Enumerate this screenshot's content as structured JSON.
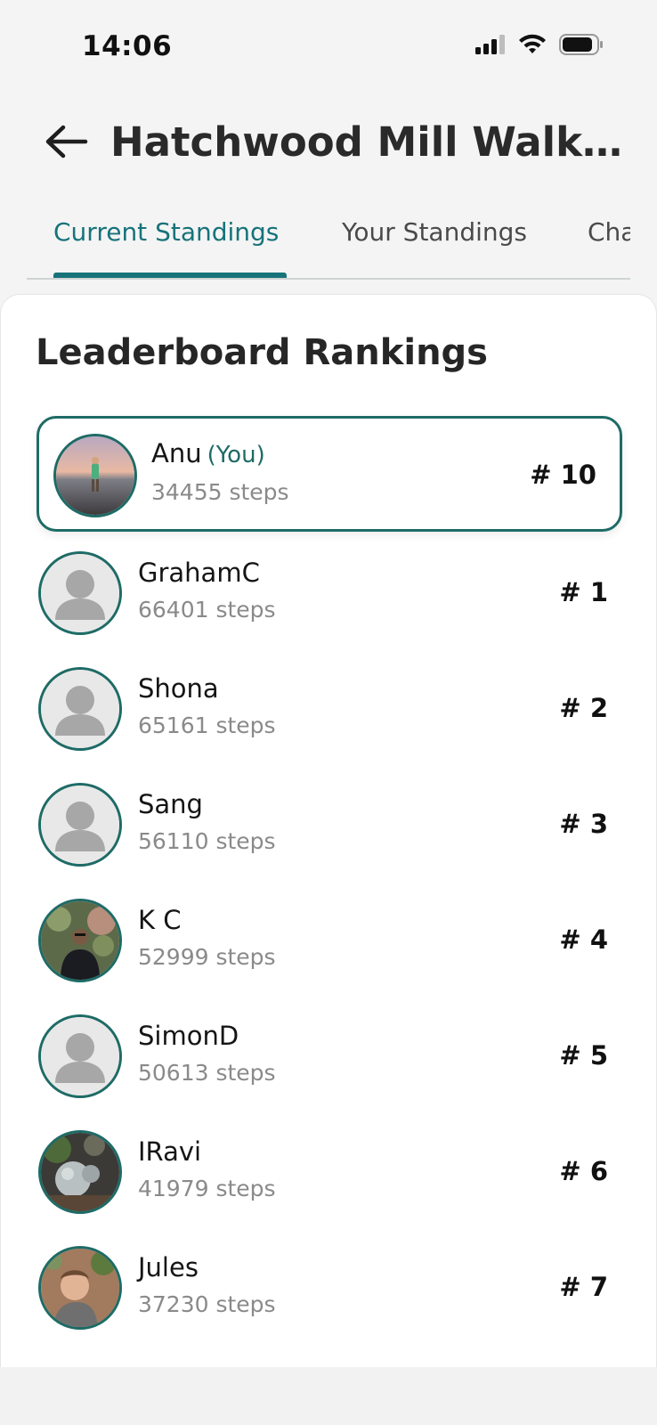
{
  "status_bar": {
    "time": "14:06",
    "icons": [
      "signal-icon",
      "wifi-icon",
      "battery-icon"
    ]
  },
  "header": {
    "back_icon": "arrow-left-icon",
    "title": "Hatchwood Mill Walkin..."
  },
  "tabs": [
    {
      "label": "Current Standings",
      "active": true
    },
    {
      "label": "Your Standings",
      "active": false
    },
    {
      "label": "Cha",
      "active": false
    }
  ],
  "leaderboard": {
    "title": "Leaderboard Rankings",
    "current_user": {
      "name": "Anu",
      "you_label": "(You)",
      "steps": "34455 steps",
      "rank": "# 10",
      "avatar": "photo"
    },
    "entries": [
      {
        "name": "GrahamC",
        "steps": "66401 steps",
        "rank": "# 1",
        "avatar": "default"
      },
      {
        "name": "Shona",
        "steps": "65161 steps",
        "rank": "# 2",
        "avatar": "default"
      },
      {
        "name": "Sang",
        "steps": "56110 steps",
        "rank": "# 3",
        "avatar": "default"
      },
      {
        "name": "K C",
        "steps": "52999 steps",
        "rank": "# 4",
        "avatar": "photo"
      },
      {
        "name": "SimonD",
        "steps": "50613 steps",
        "rank": "# 5",
        "avatar": "default"
      },
      {
        "name": "IRavi",
        "steps": "41979 steps",
        "rank": "# 6",
        "avatar": "photo"
      },
      {
        "name": "Jules",
        "steps": "37230 steps",
        "rank": "# 7",
        "avatar": "photo"
      }
    ]
  },
  "colors": {
    "accent": "#17737a",
    "avatar_ring": "#1e6b66",
    "muted_text": "#8a8a8a",
    "background": "#f4f4f4"
  }
}
